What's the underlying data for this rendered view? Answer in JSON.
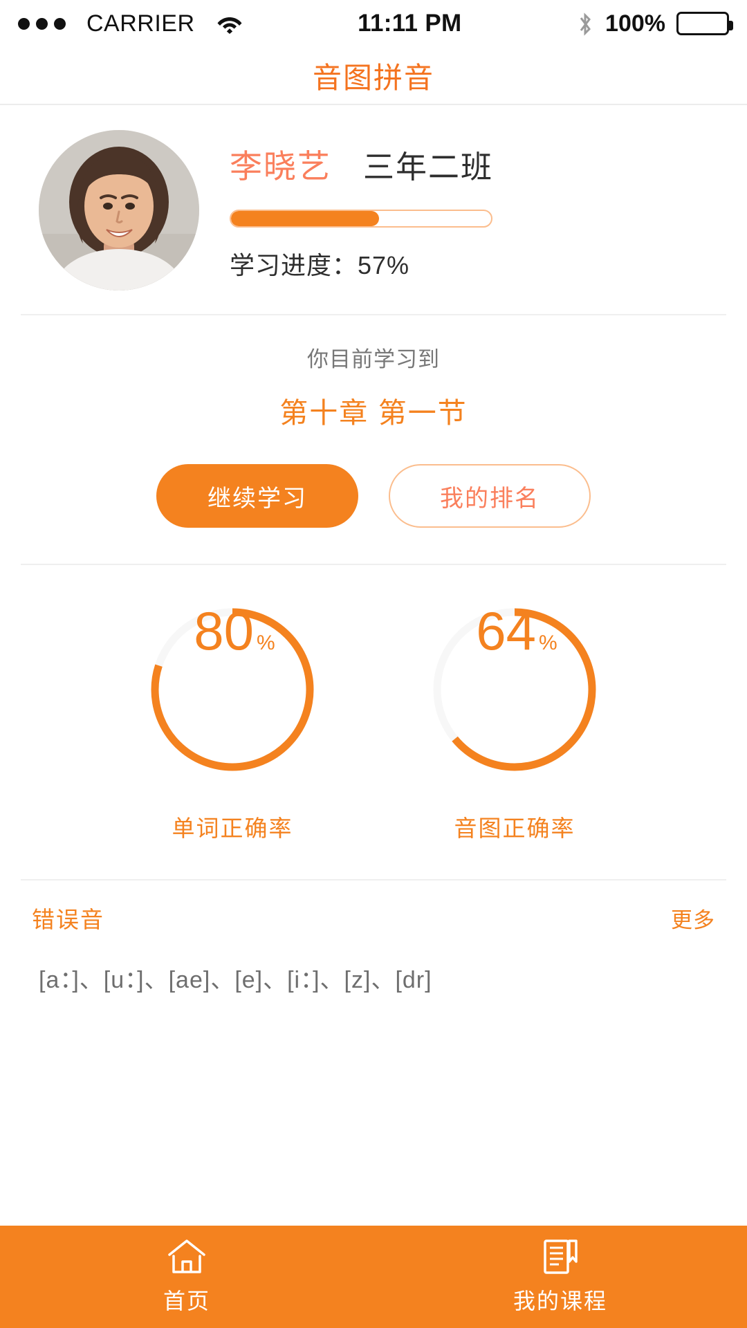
{
  "statusbar": {
    "carrier": "CARRIER",
    "time": "11:11 PM",
    "battery_percent": "100%",
    "icons": [
      "wifi-icon",
      "bluetooth-icon",
      "battery-icon"
    ]
  },
  "header": {
    "title": "音图拼音",
    "accent_color": "#f4821f"
  },
  "profile": {
    "avatar_alt": "user-avatar",
    "name": "李晓艺",
    "class": "三年二班",
    "progress_label": "学习进度：57%",
    "progress_percent": 57
  },
  "lesson": {
    "subtitle": "你目前学习到",
    "title": "第十章 第一节",
    "continue_button": "继续学习",
    "ranking_button": "我的排名"
  },
  "chart_data": [
    {
      "type": "pie",
      "title": "单词正确率",
      "value": 80,
      "display_value": "80",
      "unit": "%",
      "categories": [
        "正确",
        "错误"
      ],
      "values": [
        80,
        20
      ],
      "colors": [
        "#f4821f",
        "#f7f7f7"
      ],
      "start_angle": 0,
      "ylim": [
        0,
        100
      ]
    },
    {
      "type": "pie",
      "title": "音图正确率",
      "value": 64,
      "display_value": "64",
      "unit": "%",
      "categories": [
        "正确",
        "错误"
      ],
      "values": [
        64,
        36
      ],
      "colors": [
        "#f4821f",
        "#f7f7f7"
      ],
      "start_angle": 0,
      "ylim": [
        0,
        100
      ]
    }
  ],
  "errors": {
    "title": "错误音",
    "more": "更多",
    "list_text": "[a：]、[u：]、[ae]、[e]、[i：]、[z]、[dr]"
  },
  "tabbar": {
    "items": [
      {
        "icon": "home-icon",
        "label": "首页"
      },
      {
        "icon": "book-icon",
        "label": "我的课程"
      }
    ]
  }
}
